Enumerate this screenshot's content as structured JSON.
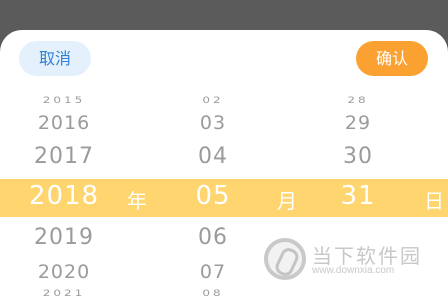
{
  "header": {
    "cancel_label": "取消",
    "confirm_label": "确认"
  },
  "picker": {
    "years": [
      "2015",
      "2016",
      "2017",
      "2018",
      "2019",
      "2020",
      "2021"
    ],
    "months": [
      "02",
      "03",
      "04",
      "05",
      "06",
      "07",
      "08"
    ],
    "days": [
      "28",
      "29",
      "30",
      "31"
    ],
    "selected": {
      "year": "2018",
      "month": "05",
      "day": "31"
    },
    "units": {
      "year": "年",
      "month": "月",
      "day": "日"
    }
  },
  "watermark": {
    "title": "当下软件园",
    "url": "www.downxia.com"
  },
  "colors": {
    "overlay": "#5b5b5b",
    "selection_band": "#fed56e",
    "confirm_button": "#fba132",
    "cancel_button_bg": "#e4f1fd",
    "cancel_text": "#2f7fd4",
    "unselected_text": "#9b9b9b"
  }
}
